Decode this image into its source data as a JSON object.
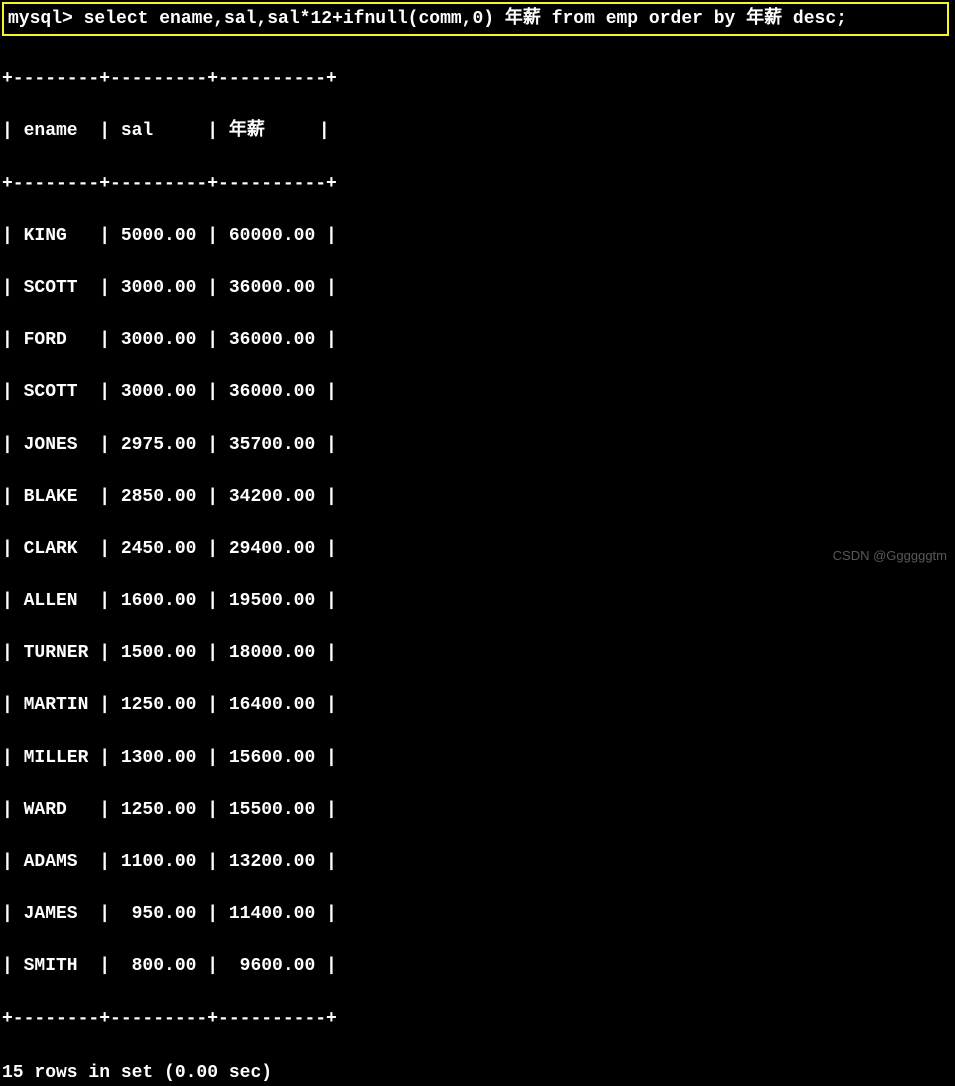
{
  "prompt": "mysql> ",
  "query": "select ename,sal,sal*12+ifnull(comm,0) 年薪 from emp order by 年薪 desc;",
  "table": {
    "border_top": "+--------+---------+----------+",
    "header_line": "| ename  | sal     | 年薪     |",
    "border_mid": "+--------+---------+----------+",
    "rows": [
      "| KING   | 5000.00 | 60000.00 |",
      "| SCOTT  | 3000.00 | 36000.00 |",
      "| FORD   | 3000.00 | 36000.00 |",
      "| SCOTT  | 3000.00 | 36000.00 |",
      "| JONES  | 2975.00 | 35700.00 |",
      "| BLAKE  | 2850.00 | 34200.00 |",
      "| CLARK  | 2450.00 | 29400.00 |",
      "| ALLEN  | 1600.00 | 19500.00 |",
      "| TURNER | 1500.00 | 18000.00 |",
      "| MARTIN | 1250.00 | 16400.00 |",
      "| MILLER | 1300.00 | 15600.00 |",
      "| WARD   | 1250.00 | 15500.00 |",
      "| ADAMS  | 1100.00 | 13200.00 |",
      "| JAMES  |  950.00 | 11400.00 |",
      "| SMITH  |  800.00 |  9600.00 |"
    ],
    "border_bottom": "+--------+---------+----------+"
  },
  "footer": "15 rows in set (0.00 sec)",
  "watermark": "CSDN @Ggggggtm",
  "chart_data": {
    "type": "table",
    "columns": [
      "ename",
      "sal",
      "年薪"
    ],
    "data": [
      {
        "ename": "KING",
        "sal": 5000.0,
        "年薪": 60000.0
      },
      {
        "ename": "SCOTT",
        "sal": 3000.0,
        "年薪": 36000.0
      },
      {
        "ename": "FORD",
        "sal": 3000.0,
        "年薪": 36000.0
      },
      {
        "ename": "SCOTT",
        "sal": 3000.0,
        "年薪": 36000.0
      },
      {
        "ename": "JONES",
        "sal": 2975.0,
        "年薪": 35700.0
      },
      {
        "ename": "BLAKE",
        "sal": 2850.0,
        "年薪": 34200.0
      },
      {
        "ename": "CLARK",
        "sal": 2450.0,
        "年薪": 29400.0
      },
      {
        "ename": "ALLEN",
        "sal": 1600.0,
        "年薪": 19500.0
      },
      {
        "ename": "TURNER",
        "sal": 1500.0,
        "年薪": 18000.0
      },
      {
        "ename": "MARTIN",
        "sal": 1250.0,
        "年薪": 16400.0
      },
      {
        "ename": "MILLER",
        "sal": 1300.0,
        "年薪": 15600.0
      },
      {
        "ename": "WARD",
        "sal": 1250.0,
        "年薪": 15500.0
      },
      {
        "ename": "ADAMS",
        "sal": 1100.0,
        "年薪": 13200.0
      },
      {
        "ename": "JAMES",
        "sal": 950.0,
        "年薪": 11400.0
      },
      {
        "ename": "SMITH",
        "sal": 800.0,
        "年薪": 9600.0
      }
    ],
    "row_count": 15,
    "query_time_sec": 0.0
  }
}
